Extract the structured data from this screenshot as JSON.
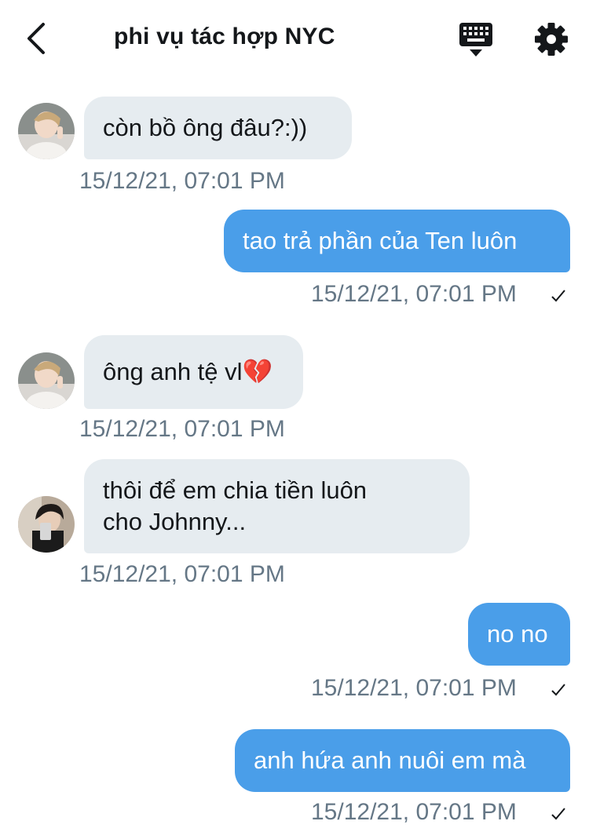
{
  "header": {
    "title": "phi vụ tác hợp NYC"
  },
  "messages": [
    {
      "direction": "in",
      "avatar": "avatar-1",
      "text": "còn bồ ông đâu?:))",
      "time": "15/12/21, 07:01 PM"
    },
    {
      "direction": "out",
      "text": "tao trả phần của Ten luôn",
      "time": "15/12/21, 07:01 PM"
    },
    {
      "direction": "in",
      "avatar": "avatar-1",
      "text": "ông anh tệ vl💔",
      "time": "15/12/21, 07:01 PM"
    },
    {
      "direction": "in",
      "avatar": "avatar-2",
      "text_line1": "thôi để em chia tiền luôn",
      "text_line2": "cho Johnny...",
      "time": "15/12/21, 07:01 PM"
    },
    {
      "direction": "out",
      "text": "no no",
      "time": "15/12/21, 07:01 PM"
    },
    {
      "direction": "out",
      "text": "anh hứa anh nuôi em mà",
      "time": "15/12/21, 07:01 PM"
    }
  ],
  "colors": {
    "incoming_bubble": "#e6ecf0",
    "outgoing_bubble": "#4a9ee9",
    "timestamp": "#657786"
  },
  "icons": {
    "back": "chevron-left-icon",
    "keyboard": "keyboard-icon",
    "settings": "gear-icon",
    "sent": "checkmark-icon"
  }
}
